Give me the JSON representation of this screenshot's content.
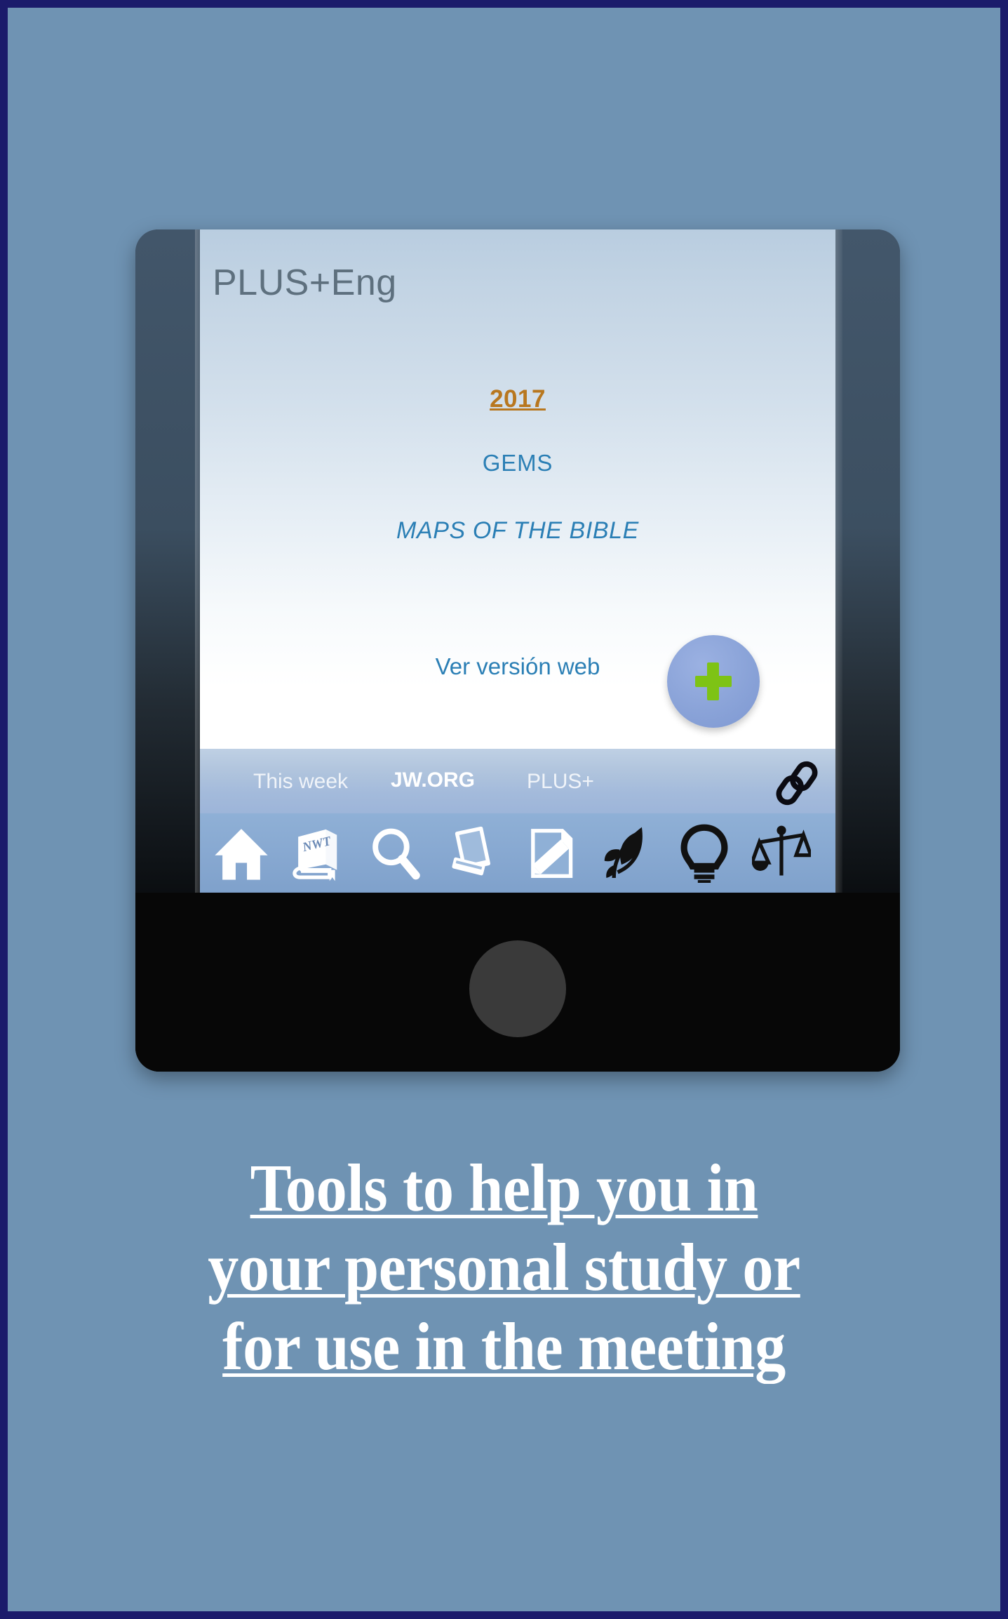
{
  "poster": {
    "background_color": "#6f93b3",
    "border_color": "#1b1b6b",
    "caption_lines": [
      "Tools to help you in",
      "your personal study or",
      "for use in the meeting"
    ]
  },
  "app": {
    "title": "PLUS+Eng",
    "title_color": "#5e707e",
    "content": {
      "year": "2017",
      "year_color": "#b8771f",
      "section": "GEMS",
      "section_color": "#2b7fb5",
      "subtitle": "MAPS OF THE BIBLE",
      "subtitle_color": "#2b7fb5",
      "web_link": "Ver versión web",
      "web_link_color": "#2b7fb5"
    },
    "fab": {
      "icon": "plus-icon",
      "circle_color": "#8aa3d8",
      "plus_color": "#7ec315"
    },
    "tabs": [
      {
        "label": "This week",
        "active": false
      },
      {
        "label": "JW.ORG",
        "active": true
      },
      {
        "label": "PLUS+",
        "active": false
      }
    ],
    "tab_link_icon": "chain-link-icon",
    "toolbar_icons": [
      {
        "name": "home-icon",
        "color": "#ffffff"
      },
      {
        "name": "nwt-bible-book-icon",
        "color": "#ffffff"
      },
      {
        "name": "search-magnifier-icon",
        "color": "#ffffff"
      },
      {
        "name": "publications-books-icon",
        "color": "#ffffff"
      },
      {
        "name": "note-pencil-icon",
        "color": "#ffffff"
      },
      {
        "name": "leaf-branch-icon",
        "color": "#111111"
      },
      {
        "name": "lightbulb-icon",
        "color": "#111111"
      },
      {
        "name": "balance-scales-icon",
        "color": "#111111"
      }
    ]
  },
  "phone": {
    "home_button": "home-button",
    "frame_color": "#0a0a0a"
  }
}
